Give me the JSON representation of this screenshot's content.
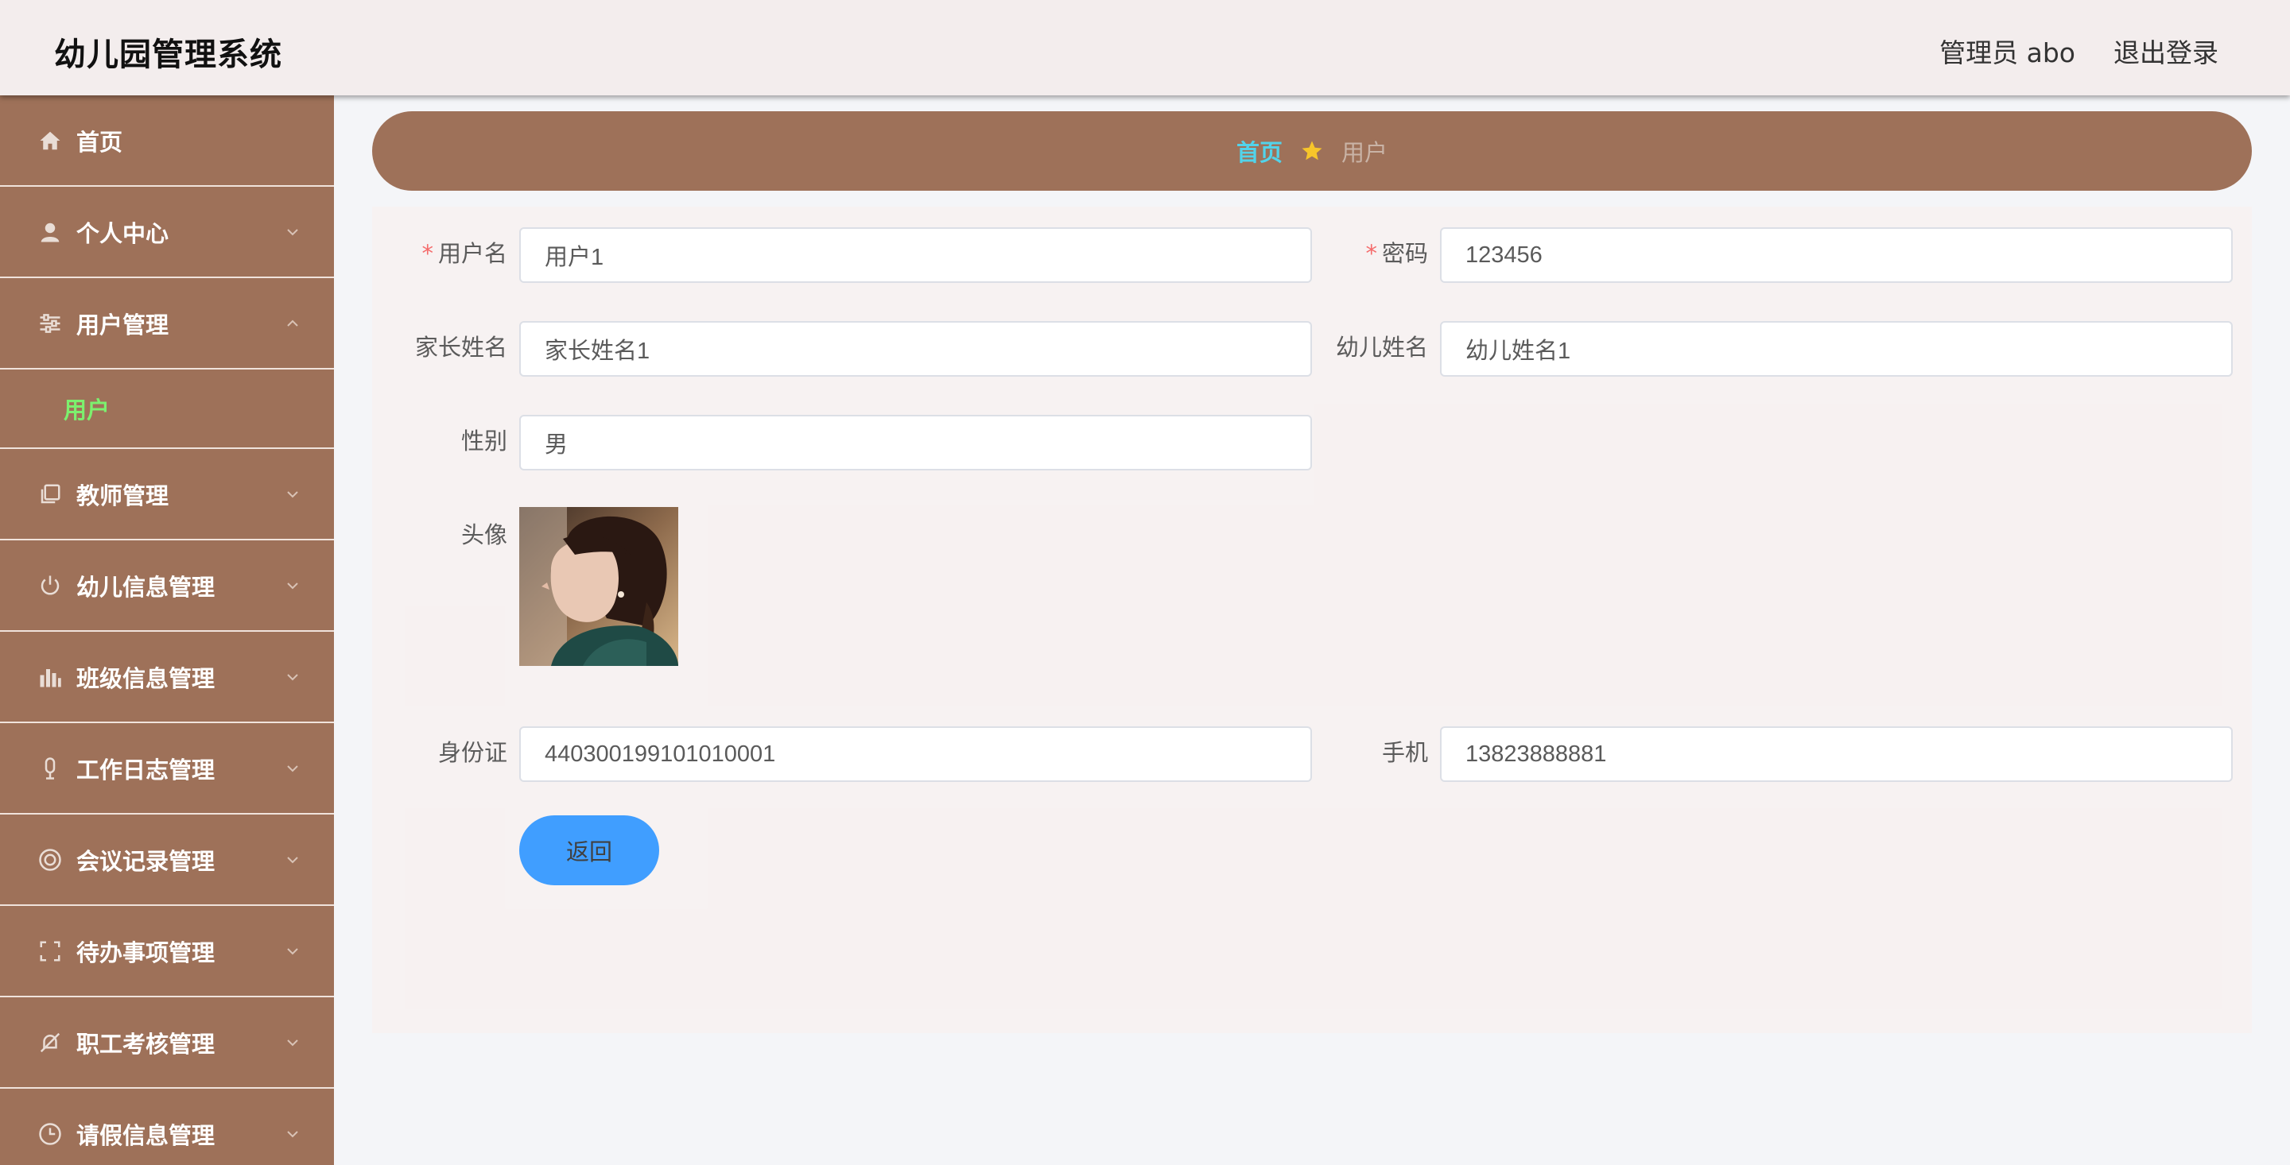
{
  "header": {
    "title": "幼儿园管理系统",
    "user_label": "管理员 abo",
    "logout_label": "退出登录"
  },
  "sidebar": {
    "items": [
      {
        "label": "首页",
        "icon": "home-icon"
      },
      {
        "label": "个人中心",
        "icon": "user-icon"
      },
      {
        "label": "用户管理",
        "icon": "sliders-icon",
        "expanded": true,
        "children": [
          {
            "label": "用户"
          }
        ]
      },
      {
        "label": "教师管理",
        "icon": "copy-icon"
      },
      {
        "label": "幼儿信息管理",
        "icon": "power-icon"
      },
      {
        "label": "班级信息管理",
        "icon": "bar-chart-icon"
      },
      {
        "label": "工作日志管理",
        "icon": "microphone-icon"
      },
      {
        "label": "会议记录管理",
        "icon": "lifebuoy-icon"
      },
      {
        "label": "待办事项管理",
        "icon": "fullscreen-icon"
      },
      {
        "label": "职工考核管理",
        "icon": "bell-off-icon"
      },
      {
        "label": "请假信息管理",
        "icon": "clock-icon"
      }
    ]
  },
  "breadcrumb": {
    "home": "首页",
    "current": "用户",
    "separator_icon": "star-icon"
  },
  "form": {
    "username": {
      "label": "用户名",
      "value": "用户1",
      "required": true
    },
    "password": {
      "label": "密码",
      "value": "123456",
      "required": true
    },
    "parent_name": {
      "label": "家长姓名",
      "value": "家长姓名1"
    },
    "child_name": {
      "label": "幼儿姓名",
      "value": "幼儿姓名1"
    },
    "gender": {
      "label": "性别",
      "value": "男"
    },
    "avatar": {
      "label": "头像"
    },
    "id_card": {
      "label": "身份证",
      "value": "440300199101010001"
    },
    "phone": {
      "label": "手机",
      "value": "13823888881"
    },
    "back_label": "返回"
  },
  "colors": {
    "sidebar_bg": "#9e7159",
    "header_bg": "#f3eded",
    "submenu_active": "#7cf06e",
    "breadcrumb_home": "#52d3ea",
    "primary_button": "#409eff",
    "required_star": "#f56c6c"
  }
}
